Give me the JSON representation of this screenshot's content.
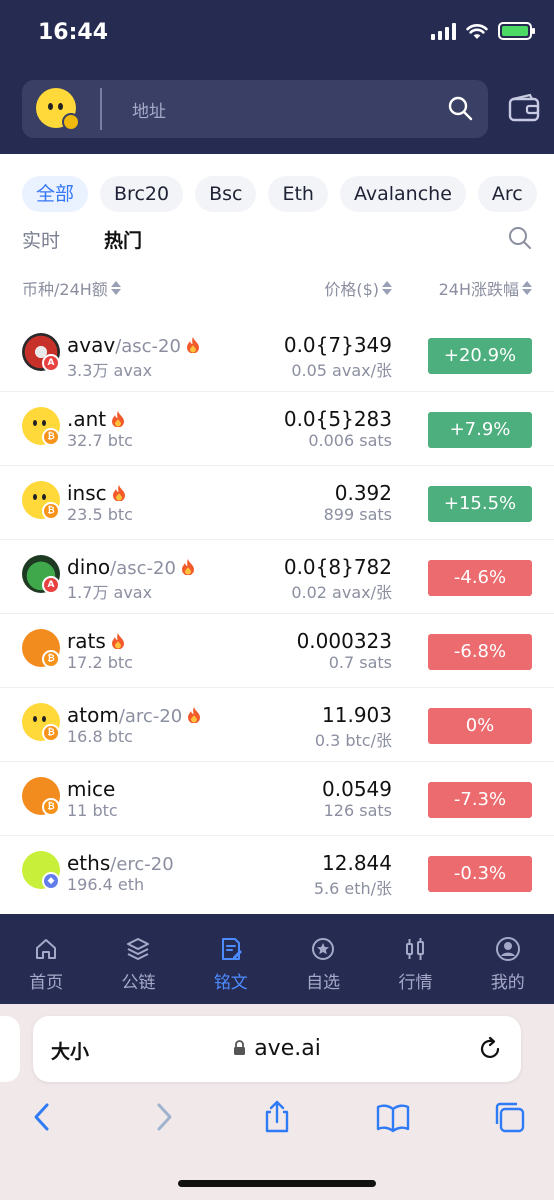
{
  "status": {
    "time": "16:44"
  },
  "header": {
    "search_placeholder": "地址"
  },
  "chips": [
    "全部",
    "Brc20",
    "Bsc",
    "Eth",
    "Avalanche",
    "Arc"
  ],
  "subtabs": [
    "实时",
    "热门"
  ],
  "columns": {
    "token": "币种/24H额",
    "price": "价格($)",
    "change": "24H涨跌幅"
  },
  "tokens": [
    {
      "name": "avav",
      "protocol": "/asc-20",
      "hot": true,
      "volume": "3.3万 avax",
      "price": "0.0{7}349",
      "sub": "0.05 avax/张",
      "change": "+20.9%",
      "trend": "up",
      "chain": "avax",
      "icon": "avav-token-icon"
    },
    {
      "name": ".ant",
      "protocol": "",
      "hot": true,
      "volume": "32.7 btc",
      "price": "0.0{5}283",
      "sub": "0.006 sats",
      "change": "+7.9%",
      "trend": "up",
      "chain": "btc",
      "icon": "ant-token-icon"
    },
    {
      "name": "insc",
      "protocol": "",
      "hot": true,
      "volume": "23.5 btc",
      "price": "0.392",
      "sub": "899 sats",
      "change": "+15.5%",
      "trend": "up",
      "chain": "btc",
      "icon": "insc-token-icon"
    },
    {
      "name": "dino",
      "protocol": "/asc-20",
      "hot": true,
      "volume": "1.7万 avax",
      "price": "0.0{8}782",
      "sub": "0.02 avax/张",
      "change": "-4.6%",
      "trend": "down",
      "chain": "avax",
      "icon": "dino-token-icon"
    },
    {
      "name": "rats",
      "protocol": "",
      "hot": true,
      "volume": "17.2 btc",
      "price": "0.000323",
      "sub": "0.7 sats",
      "change": "-6.8%",
      "trend": "down",
      "chain": "btc",
      "icon": "rats-token-icon"
    },
    {
      "name": "atom",
      "protocol": "/arc-20",
      "hot": true,
      "volume": "16.8 btc",
      "price": "11.903",
      "sub": "0.3 btc/张",
      "change": "0%",
      "trend": "down",
      "chain": "btc",
      "icon": "atom-token-icon"
    },
    {
      "name": "mice",
      "protocol": "",
      "hot": false,
      "volume": "11 btc",
      "price": "0.0549",
      "sub": "126 sats",
      "change": "-7.3%",
      "trend": "down",
      "chain": "btc",
      "icon": "mice-token-icon"
    },
    {
      "name": "eths",
      "protocol": "/erc-20",
      "hot": false,
      "volume": "196.4 eth",
      "price": "12.844",
      "sub": "5.6 eth/张",
      "change": "-0.3%",
      "trend": "down",
      "chain": "eth",
      "icon": "eths-token-icon"
    }
  ],
  "nav": [
    {
      "label": "首页",
      "icon": "home-icon"
    },
    {
      "label": "公链",
      "icon": "layers-icon"
    },
    {
      "label": "铭文",
      "icon": "inscription-icon",
      "active": true
    },
    {
      "label": "自选",
      "icon": "star-icon"
    },
    {
      "label": "行情",
      "icon": "candlestick-icon"
    },
    {
      "label": "我的",
      "icon": "user-icon"
    }
  ],
  "browser": {
    "text_size": "大小",
    "url": "ave.ai"
  },
  "colors": {
    "header_bg": "#262b52",
    "accent": "#3478f6",
    "up": "#4caf7d",
    "down": "#ec6b6f",
    "btc_badge": "#f7931a",
    "avax_badge": "#e84142",
    "eth_badge": "#627eea"
  }
}
